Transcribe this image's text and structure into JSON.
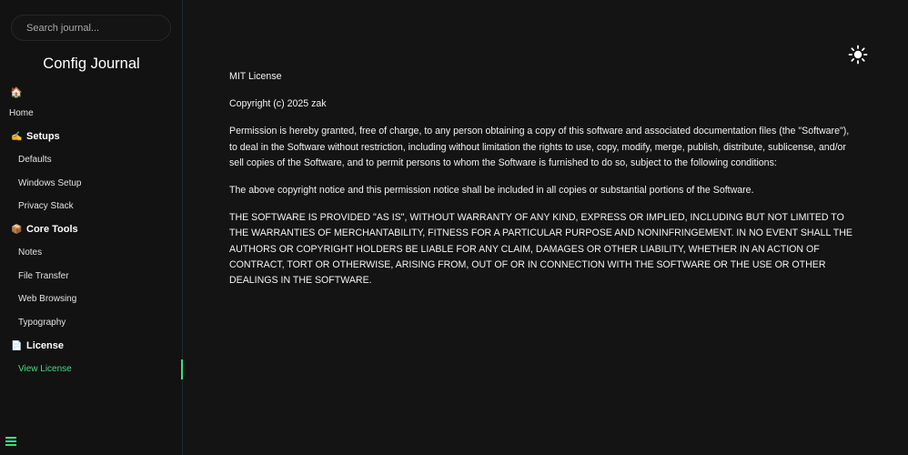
{
  "search": {
    "placeholder": "Search journal..."
  },
  "sidebar": {
    "title": "Config Journal",
    "home": {
      "icon": "home-icon",
      "label": "Home"
    },
    "sections": [
      {
        "icon": "writing-hand-icon",
        "label": "Setups",
        "items": [
          {
            "label": "Defaults"
          },
          {
            "label": "Windows Setup"
          },
          {
            "label": "Privacy Stack"
          }
        ]
      },
      {
        "icon": "package-icon",
        "label": "Core Tools",
        "items": [
          {
            "label": "Notes"
          },
          {
            "label": "File Transfer"
          },
          {
            "label": "Web Browsing"
          },
          {
            "label": "Typography"
          }
        ]
      },
      {
        "icon": "page-icon",
        "label": "License",
        "items": [
          {
            "label": "View License",
            "active": true
          }
        ]
      }
    ],
    "menu_icon": "hamburger-icon"
  },
  "header": {
    "theme_toggle_icon": "sun-icon"
  },
  "main": {
    "paragraphs": [
      "MIT License",
      "Copyright (c) 2025 zak",
      "Permission is hereby granted, free of charge, to any person obtaining a copy of this software and associated documentation files (the \"Software\"), to deal in the Software without restriction, including without limitation the rights to use, copy, modify, merge, publish, distribute, sublicense, and/or sell copies of the Software, and to permit persons to whom the Software is furnished to do so, subject to the following conditions:",
      "The above copyright notice and this permission notice shall be included in all copies or substantial portions of the Software.",
      "THE SOFTWARE IS PROVIDED \"AS IS\", WITHOUT WARRANTY OF ANY KIND, EXPRESS OR IMPLIED, INCLUDING BUT NOT LIMITED TO THE WARRANTIES OF MERCHANTABILITY, FITNESS FOR A PARTICULAR PURPOSE AND NONINFRINGEMENT. IN NO EVENT SHALL THE AUTHORS OR COPYRIGHT HOLDERS BE LIABLE FOR ANY CLAIM, DAMAGES OR OTHER LIABILITY, WHETHER IN AN ACTION OF CONTRACT, TORT OR OTHERWISE, ARISING FROM, OUT OF OR IN CONNECTION WITH THE SOFTWARE OR THE USE OR OTHER DEALINGS IN THE SOFTWARE."
    ]
  },
  "colors": {
    "background": "#141414",
    "sidebar": "#121212",
    "accent": "#3ddc84",
    "text": "#f2f2f2"
  }
}
